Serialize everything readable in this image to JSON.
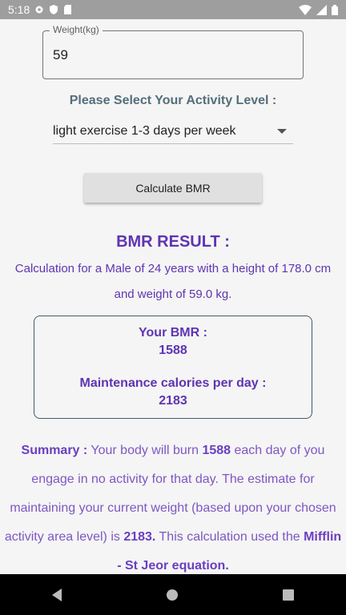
{
  "status_bar": {
    "time": "5:18",
    "left_icons": [
      "settings-icon",
      "shield-icon",
      "sd-card-icon"
    ],
    "right_icons": [
      "wifi-icon",
      "signal-icon",
      "battery-icon"
    ]
  },
  "weight": {
    "label": "Weight(kg)",
    "value": "59"
  },
  "activity": {
    "title": "Please Select Your Activity Level :",
    "selected": "light exercise 1-3 days per week"
  },
  "calculate_button": "Calculate BMR",
  "result": {
    "title": "BMR RESULT :",
    "description": "Calculation for a Male of 24 years with a height of 178.0 cm and weight of 59.0 kg.",
    "bmr_label": "Your BMR :",
    "bmr_value": "1588",
    "maintenance_label": "Maintenance calories per day :",
    "maintenance_value": "2183"
  },
  "summary": {
    "label": "Summary :",
    "text1": " Your body will burn ",
    "bmr": "1588",
    "text2": " each day of you engage in no activity for that day. The estimate for maintaining your current weight (based upon your chosen activity area level) is ",
    "calories": "2183.",
    "text3": " This calculation used the ",
    "equation": "Mifflin - St Jeor equation."
  },
  "nav": [
    "back-icon",
    "home-icon",
    "recents-icon"
  ]
}
